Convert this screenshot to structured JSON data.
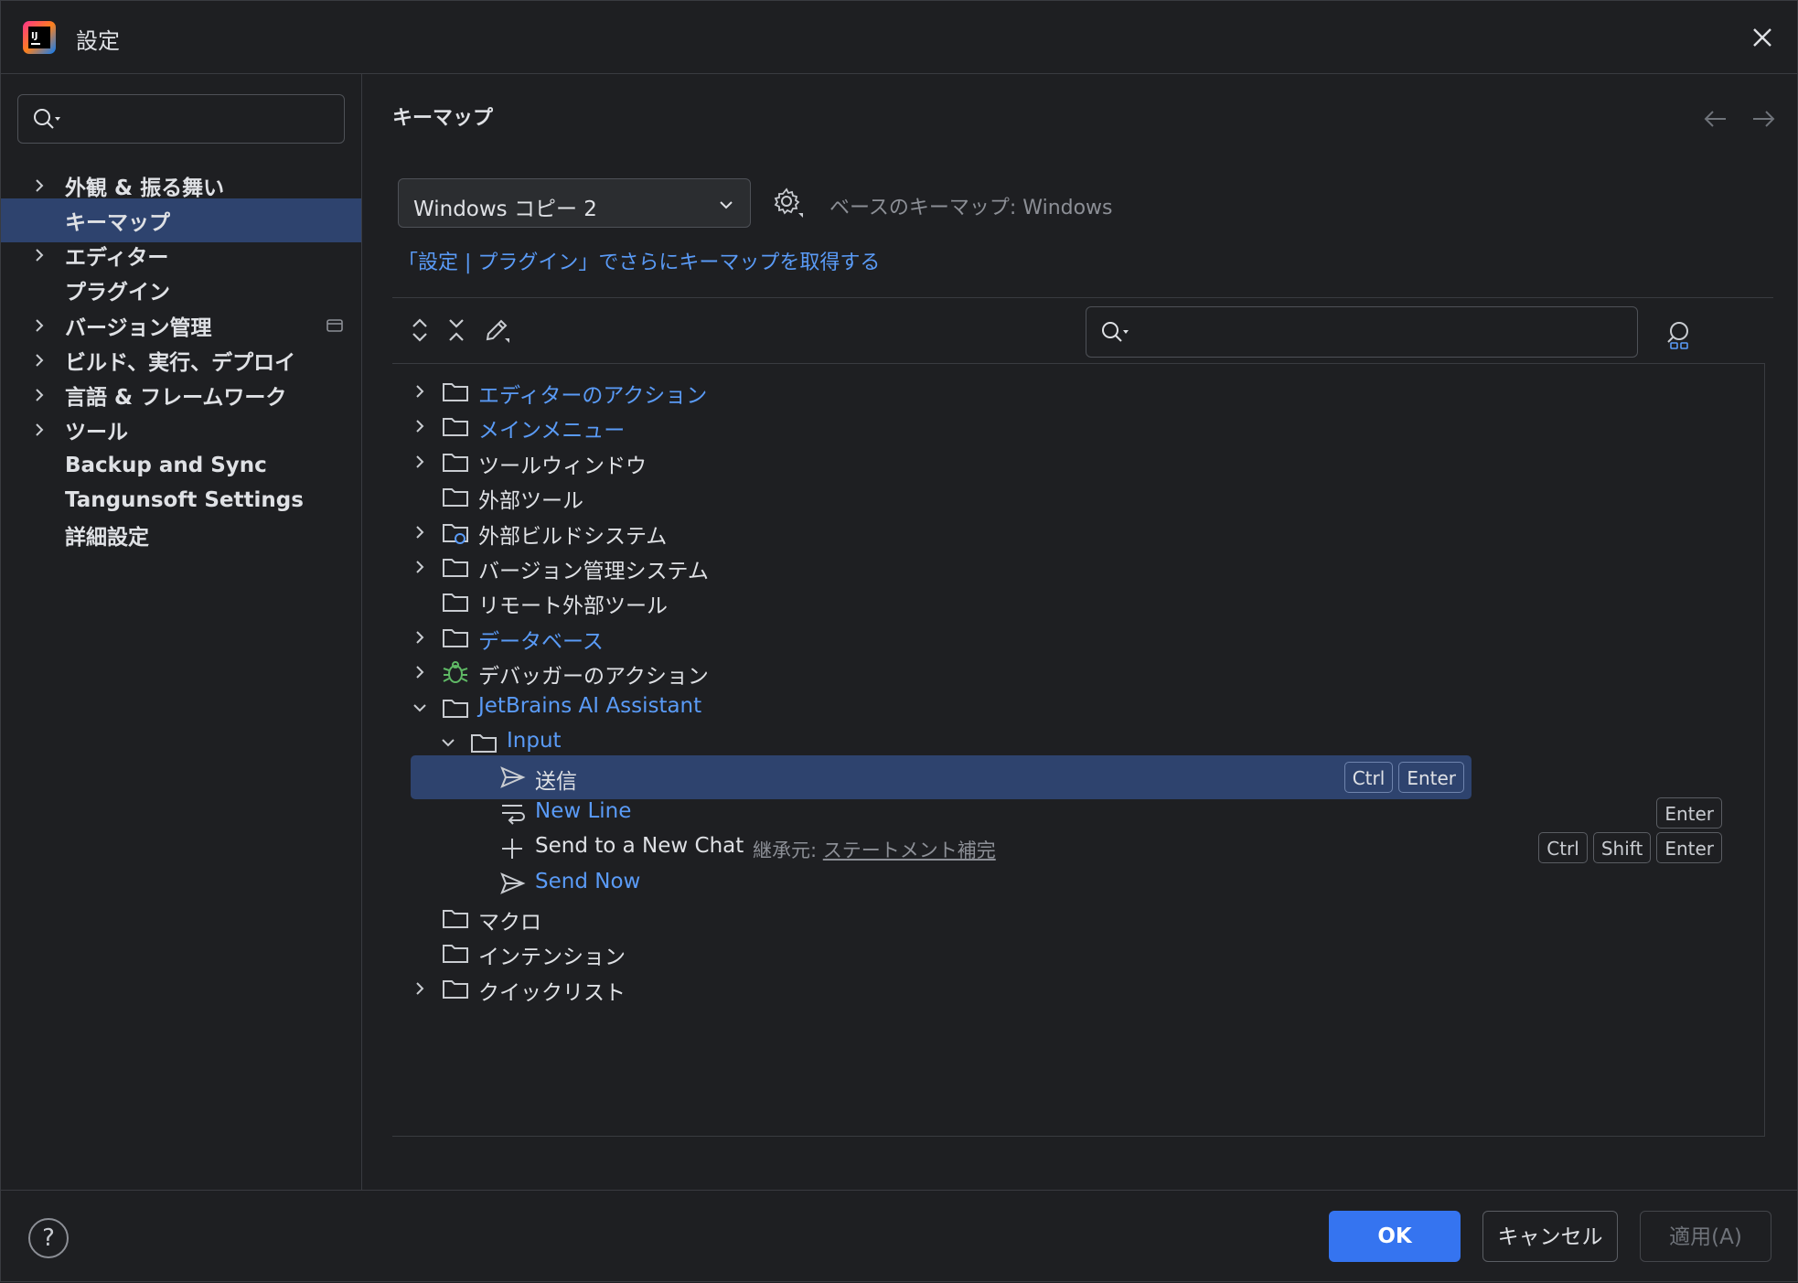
{
  "window": {
    "title": "設定"
  },
  "sidebar": {
    "search_placeholder": "",
    "items": [
      {
        "label": "外観 & 振る舞い",
        "expandable": true
      },
      {
        "label": "キーマップ",
        "expandable": false,
        "selected": true
      },
      {
        "label": "エディター",
        "expandable": true
      },
      {
        "label": "プラグイン",
        "expandable": false
      },
      {
        "label": "バージョン管理",
        "expandable": true
      },
      {
        "label": "ビルド、実行、デプロイ",
        "expandable": true
      },
      {
        "label": "言語 & フレームワーク",
        "expandable": true
      },
      {
        "label": "ツール",
        "expandable": true
      },
      {
        "label": "Backup and Sync",
        "expandable": false
      },
      {
        "label": "Tangunsoft Settings",
        "expandable": false
      },
      {
        "label": "詳細設定",
        "expandable": false
      }
    ]
  },
  "main": {
    "title": "キーマップ",
    "keymap_value": "Windows コピー 2",
    "base_keymap": "ベースのキーマップ: Windows",
    "plugins_link": "「設定 | プラグイン」でさらにキーマップを取得する",
    "search_placeholder": ""
  },
  "tree": [
    {
      "label": "エディターのアクション",
      "color": "blue",
      "level": 0,
      "chevron": "right",
      "icon": "folder-icon"
    },
    {
      "label": "メインメニュー",
      "color": "blue",
      "level": 0,
      "chevron": "right",
      "icon": "folder-icon"
    },
    {
      "label": "ツールウィンドウ",
      "color": "white",
      "level": 0,
      "chevron": "right",
      "icon": "folder-icon"
    },
    {
      "label": "外部ツール",
      "color": "white",
      "level": 0,
      "chevron": "none",
      "icon": "folder-icon"
    },
    {
      "label": "外部ビルドシステム",
      "color": "white",
      "level": 0,
      "chevron": "right",
      "icon": "folder-gear-icon"
    },
    {
      "label": "バージョン管理システム",
      "color": "white",
      "level": 0,
      "chevron": "right",
      "icon": "folder-icon"
    },
    {
      "label": "リモート外部ツール",
      "color": "white",
      "level": 0,
      "chevron": "none",
      "icon": "folder-icon"
    },
    {
      "label": "データベース",
      "color": "blue",
      "level": 0,
      "chevron": "right",
      "icon": "folder-icon"
    },
    {
      "label": "デバッガーのアクション",
      "color": "white",
      "level": 0,
      "chevron": "right",
      "icon": "bug-icon"
    },
    {
      "label": "JetBrains AI Assistant",
      "color": "blue",
      "level": 0,
      "chevron": "down",
      "icon": "folder-icon"
    },
    {
      "label": "Input",
      "color": "blue",
      "level": 1,
      "chevron": "down",
      "icon": "folder-icon"
    },
    {
      "label": "送信",
      "color": "white",
      "level": 2,
      "chevron": "none",
      "icon": "send-icon",
      "selected": true,
      "keys": [
        "Ctrl",
        "Enter"
      ]
    },
    {
      "label": "New Line",
      "color": "blue",
      "level": 2,
      "chevron": "none",
      "icon": "newline-icon",
      "keys": [
        "Enter"
      ]
    },
    {
      "label": "Send to a New Chat",
      "color": "white",
      "level": 2,
      "chevron": "none",
      "icon": "plus-icon",
      "inherit_prefix": "継承元: ",
      "inherit_link": "ステートメント補完",
      "keys": [
        "Ctrl",
        "Shift",
        "Enter"
      ]
    },
    {
      "label": "Send Now",
      "color": "blue",
      "level": 2,
      "chevron": "none",
      "icon": "send-icon"
    },
    {
      "label": "マクロ",
      "color": "white",
      "level": 0,
      "chevron": "none",
      "icon": "folder-icon"
    },
    {
      "label": "インテンション",
      "color": "white",
      "level": 0,
      "chevron": "none",
      "icon": "folder-icon"
    },
    {
      "label": "クイックリスト",
      "color": "white",
      "level": 0,
      "chevron": "right",
      "icon": "folder-icon"
    }
  ],
  "footer": {
    "help": "?",
    "ok": "OK",
    "cancel": "キャンセル",
    "apply": "適用(A)"
  },
  "colors": {
    "background": "#1e1f22",
    "selection": "#2e436e",
    "accent": "#3574f0",
    "link": "#5a9bf7"
  }
}
